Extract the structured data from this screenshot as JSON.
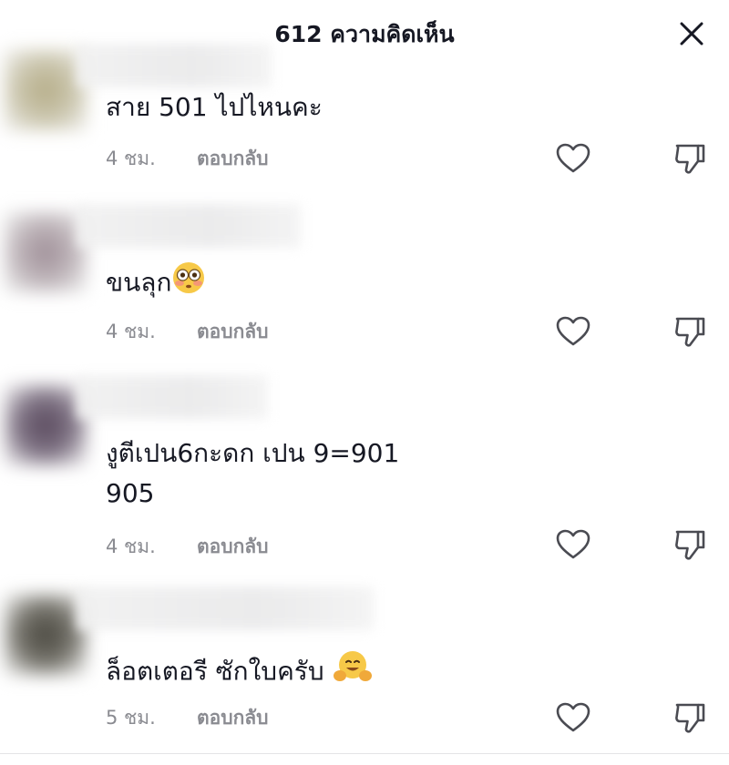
{
  "header": {
    "title": "612 ความคิดเห็น",
    "close_icon": "close-icon"
  },
  "comments": [
    {
      "text": "สาย 501 ไปไหนคะ",
      "time": "4 ชม.",
      "reply": "ตอบกลับ",
      "avatar_color": "#bdb79a",
      "emoji": ""
    },
    {
      "text": "ขนลุก",
      "time": "4 ชม.",
      "reply": "ตอบกลับ",
      "avatar_color": "#a79aa2",
      "emoji": "flushed-face-emoji"
    },
    {
      "text_line1": "งูตีเปน6กะดก เปน 9=901",
      "text_line2": "905",
      "time": "4 ชม.",
      "reply": "ตอบกลับ",
      "avatar_color": "#5e4e62",
      "emoji": ""
    },
    {
      "text": "ล็อตเตอรี ซักใบครับ",
      "time": "5 ชม.",
      "reply": "ตอบกลับ",
      "avatar_color": "#4d4b44",
      "emoji": "hugging-face-emoji"
    }
  ],
  "icons": {
    "like": "heart-outline-icon",
    "dislike": "thumbs-down-outline-icon"
  }
}
